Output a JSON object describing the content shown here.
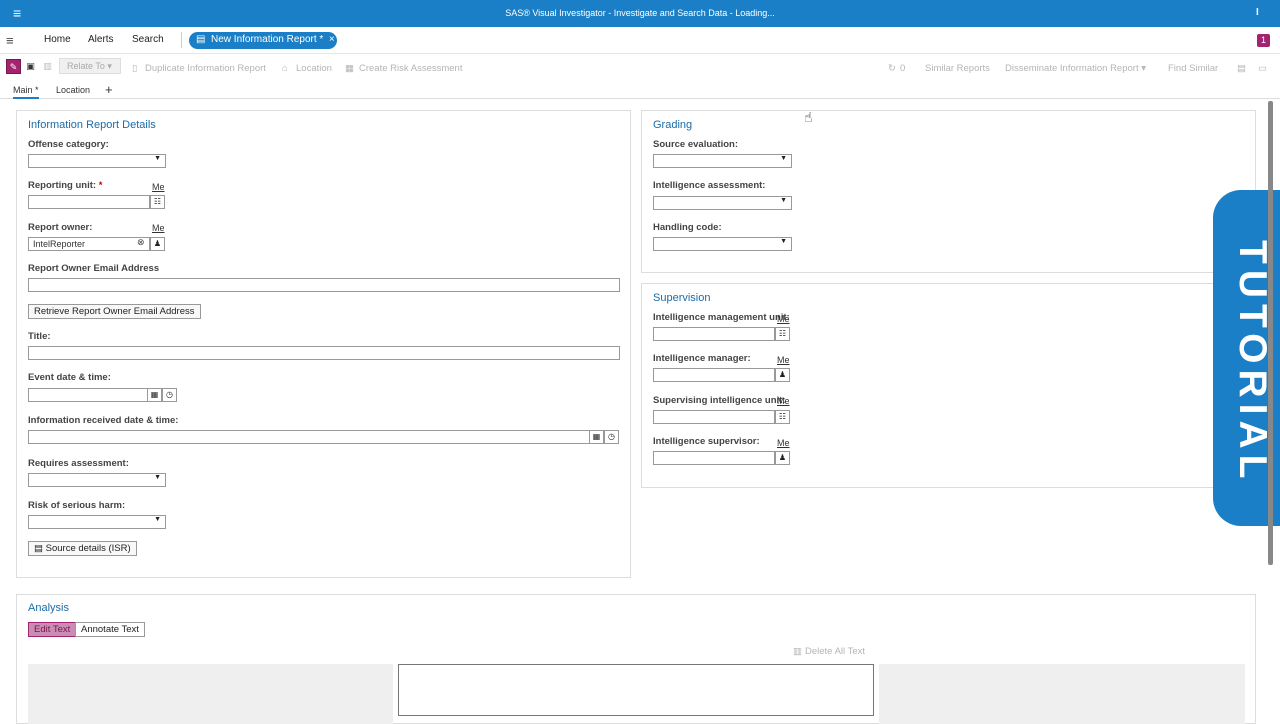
{
  "app": {
    "title": "SAS® Visual Investigator - Investigate and Search Data - Loading...",
    "user_initial": "I",
    "menu_icon": "hamburger-icon"
  },
  "nav": {
    "links": [
      "Home",
      "Alerts",
      "Search"
    ],
    "active_tab": "New Information Report *",
    "tab_close": "×",
    "notification_count": "1"
  },
  "toolbar": {
    "relate_to": "Relate To ▾",
    "duplicate": "Duplicate Information Report",
    "location": "Location",
    "create_risk": "Create Risk Assessment",
    "count": "0",
    "similar_reports": "Similar Reports",
    "disseminate": "Disseminate Information Report ▾",
    "find_similar": "Find Similar"
  },
  "subtabs": {
    "main": "Main *",
    "location": "Location",
    "add": "+"
  },
  "details": {
    "title": "Information Report Details",
    "offense_category": "Offense category:",
    "reporting_unit": "Reporting unit:",
    "required_marker": "*",
    "me": "Me",
    "report_owner": "Report owner:",
    "report_owner_value": "IntelReporter",
    "owner_email": "Report Owner Email Address",
    "retrieve_button": "Retrieve Report Owner Email Address",
    "title_label": "Title:",
    "event_datetime": "Event date & time:",
    "info_received": "Information received date & time:",
    "requires_assessment": "Requires assessment:",
    "risk_harm": "Risk of serious harm:",
    "source_details": "Source details (ISR)"
  },
  "grading": {
    "title": "Grading",
    "source_evaluation": "Source evaluation:",
    "intel_assessment": "Intelligence assessment:",
    "handling_code": "Handling code:"
  },
  "supervision": {
    "title": "Supervision",
    "mgmt_unit": "Intelligence management unit:",
    "manager": "Intelligence manager:",
    "supervising_unit": "Supervising intelligence unit:",
    "supervisor": "Intelligence supervisor:",
    "me": "Me"
  },
  "analysis": {
    "title": "Analysis",
    "edit_text": "Edit Text",
    "annotate_text": "Annotate Text",
    "delete_all": "Delete All Text"
  },
  "tutorial": {
    "label": "TUTORIAL"
  }
}
